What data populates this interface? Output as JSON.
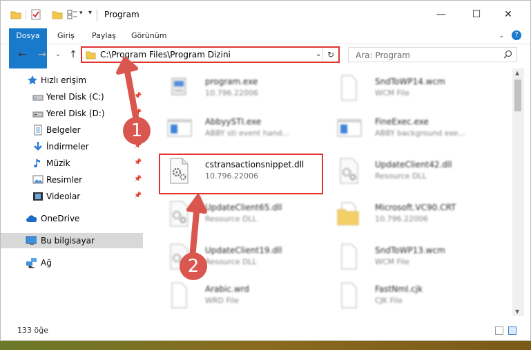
{
  "window": {
    "title": "Program",
    "minimize": "—",
    "maximize": "☐",
    "close": "✕"
  },
  "ribbon": {
    "tabs": [
      "Dosya",
      "Giriş",
      "Paylaş",
      "Görünüm"
    ],
    "help": "?"
  },
  "navigation": {
    "address": "C:\\Program Files\\Program Dizini",
    "search_placeholder": "Ara: Program"
  },
  "sidebar": {
    "items": [
      {
        "label": "Hızlı erişim",
        "icon": "star-icon",
        "pinned": false
      },
      {
        "label": "Yerel Disk (C:)",
        "icon": "drive-icon",
        "pinned": true
      },
      {
        "label": "Yerel Disk (D:)",
        "icon": "drive-icon",
        "pinned": true
      },
      {
        "label": "Belgeler",
        "icon": "documents-icon",
        "pinned": true
      },
      {
        "label": "İndirmeler",
        "icon": "download-icon",
        "pinned": true
      },
      {
        "label": "Müzik",
        "icon": "music-icon",
        "pinned": true
      },
      {
        "label": "Resimler",
        "icon": "pictures-icon",
        "pinned": true
      },
      {
        "label": "Videolar",
        "icon": "videos-icon",
        "pinned": true
      },
      {
        "label": "OneDrive",
        "icon": "cloud-icon",
        "pinned": false
      },
      {
        "label": "Bu bilgisayar",
        "icon": "computer-icon",
        "pinned": false,
        "selected": true
      },
      {
        "label": "Ağ",
        "icon": "network-icon",
        "pinned": false
      }
    ]
  },
  "files": [
    {
      "name": "program.exe",
      "meta": "10.796.22006",
      "kind": "exe-setup"
    },
    {
      "name": "SndToWP14.wcm",
      "meta": "WCM File",
      "kind": "blank"
    },
    {
      "name": "AbbyySTI.exe",
      "meta": "ABBY sti event hand...",
      "kind": "exe-window"
    },
    {
      "name": "FineExec.exe",
      "meta": "ABBY background exe...",
      "kind": "exe-window"
    },
    {
      "name": "cstransactionsnippet.dll",
      "meta": "10.796.22006",
      "kind": "dll"
    },
    {
      "name": "UpdateClient42.dll",
      "meta": "Resource DLL",
      "kind": "dll"
    },
    {
      "name": "UpdateClient65.dll",
      "meta": "Resource DLL",
      "kind": "dll"
    },
    {
      "name": "Microsoft.VC90.CRT",
      "meta": "10.796.22006",
      "kind": "folder"
    },
    {
      "name": "UpdateClient19.dll",
      "meta": "Resource DLL",
      "kind": "dll"
    },
    {
      "name": "SndToWP13.wcm",
      "meta": "WCM File",
      "kind": "blank"
    },
    {
      "name": "Arabic.wrd",
      "meta": "WRD File",
      "kind": "blank"
    },
    {
      "name": "FastNmI.cjk",
      "meta": "CJK File",
      "kind": "blank"
    }
  ],
  "status": {
    "item_count": "133 öğe"
  },
  "callouts": [
    "1",
    "2"
  ],
  "colors": {
    "accent": "#1979ca",
    "highlight_border": "#e0322f",
    "callout": "#d9574f"
  }
}
